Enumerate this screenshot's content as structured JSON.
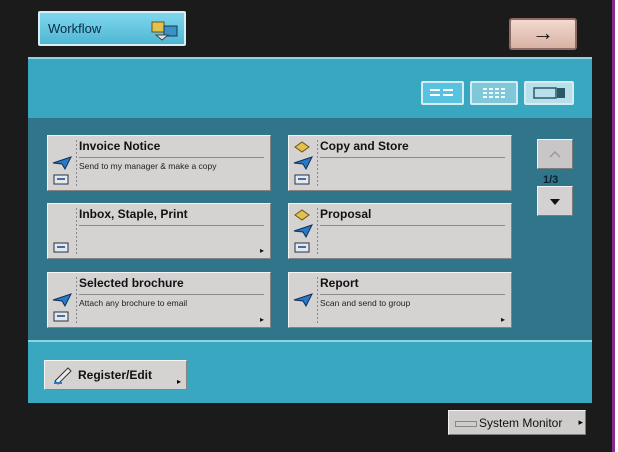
{
  "header": {
    "mode_tab_label": "Workflow",
    "next_arrow": "→"
  },
  "view_toggle": [
    "list",
    "grid",
    "card"
  ],
  "jobs": [
    {
      "title": "Invoice Notice",
      "desc": "Send to my manager & make a copy"
    },
    {
      "title": "Copy and Store",
      "desc": ""
    },
    {
      "title": "Inbox, Staple, Print",
      "desc": ""
    },
    {
      "title": "Proposal",
      "desc": ""
    },
    {
      "title": "Selected brochure",
      "desc": "Attach any brochure to email"
    },
    {
      "title": "Report",
      "desc": "Scan and send to group"
    }
  ],
  "pagination": {
    "indicator": "1/3"
  },
  "footer": {
    "register_label": "Register/Edit",
    "system_monitor_label": "System Monitor"
  },
  "colors": {
    "panel": "#3aa7c1",
    "panel_dark": "#30758a",
    "button": "#d5d2d2"
  },
  "icons": {
    "send": "send-arrow-icon",
    "print": "print-icon",
    "copy": "copy-stack-icon"
  }
}
